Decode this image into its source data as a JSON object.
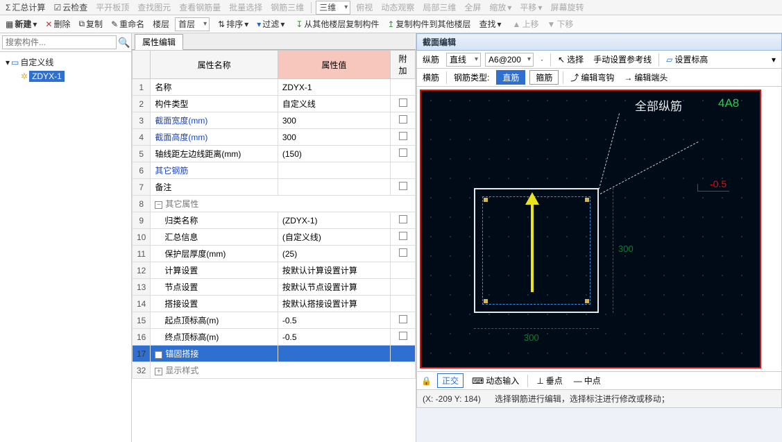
{
  "topbar": {
    "items": [
      "汇总计算",
      "云检查",
      "平开板顶",
      "查找图元",
      "查看钢筋量",
      "批量选择",
      "钢筋三维",
      "三维",
      "俯视",
      "动态观察",
      "局部三维",
      "全屏",
      "缩放",
      "平移",
      "屏幕旋转"
    ]
  },
  "toolbar2": {
    "new": "新建",
    "delete": "删除",
    "copy": "复制",
    "rename": "重命名",
    "floor_label": "楼层",
    "floor_value": "首层",
    "sort": "排序",
    "filter": "过滤",
    "copy_from": "从其他楼层复制构件",
    "copy_to": "复制构件到其他楼层",
    "find": "查找",
    "up": "上移",
    "down": "下移"
  },
  "search": {
    "placeholder": "搜索构件..."
  },
  "tree": {
    "root": "自定义线",
    "child": "ZDYX-1"
  },
  "prop_tab": "属性编辑",
  "prop_headers": {
    "name": "属性名称",
    "value": "属性值",
    "addon": "附加"
  },
  "rows": [
    {
      "n": "1",
      "name": "名称",
      "value": "ZDYX-1",
      "chk": false,
      "link": false
    },
    {
      "n": "2",
      "name": "构件类型",
      "value": "自定义线",
      "chk": true,
      "link": false
    },
    {
      "n": "3",
      "name": "截面宽度(mm)",
      "value": "300",
      "chk": true,
      "link": true
    },
    {
      "n": "4",
      "name": "截面高度(mm)",
      "value": "300",
      "chk": true,
      "link": true
    },
    {
      "n": "5",
      "name": "轴线距左边线距离(mm)",
      "value": "(150)",
      "chk": true,
      "link": false
    },
    {
      "n": "6",
      "name": "其它钢筋",
      "value": "",
      "chk": false,
      "link": true
    },
    {
      "n": "7",
      "name": "备注",
      "value": "",
      "chk": true,
      "link": false
    }
  ],
  "group_other": "其它属性",
  "rows2": [
    {
      "n": "9",
      "name": "归类名称",
      "value": "(ZDYX-1)",
      "chk": true
    },
    {
      "n": "10",
      "name": "汇总信息",
      "value": "(自定义线)",
      "chk": true
    },
    {
      "n": "11",
      "name": "保护层厚度(mm)",
      "value": "(25)",
      "chk": true
    },
    {
      "n": "12",
      "name": "计算设置",
      "value": "按默认计算设置计算",
      "chk": false
    },
    {
      "n": "13",
      "name": "节点设置",
      "value": "按默认节点设置计算",
      "chk": false
    },
    {
      "n": "14",
      "name": "搭接设置",
      "value": "按默认搭接设置计算",
      "chk": false
    },
    {
      "n": "15",
      "name": "起点顶标高(m)",
      "value": "-0.5",
      "chk": true
    },
    {
      "n": "16",
      "name": "终点顶标高(m)",
      "value": "-0.5",
      "chk": true
    }
  ],
  "row_sel": {
    "n": "17",
    "name": "锚固搭接"
  },
  "row_disp": {
    "n": "32",
    "name": "显示样式"
  },
  "right": {
    "title": "截面编辑",
    "tb1": {
      "zongjin": "纵筋",
      "zhixian": "直线",
      "spec": "A6@200",
      "select": "选择",
      "ref": "手动设置参考线",
      "elev": "设置标高"
    },
    "tb2": {
      "hengjin": "横筋",
      "type_label": "钢筋类型:",
      "zhijin": "直筋",
      "gujin": "箍筋",
      "hook": "编辑弯钩",
      "end": "编辑端头"
    },
    "anno_all": "全部纵筋",
    "anno_spec": "4A8",
    "neg": "-0.5",
    "w": "300",
    "h": "300",
    "status1": {
      "ortho": "正交",
      "dyn": "动态输入",
      "perp": "垂点",
      "mid": "中点"
    },
    "status2": {
      "coord": "(X: -209 Y: 184)",
      "hint": "选择钢筋进行编辑，选择标注进行修改或移动；"
    }
  }
}
